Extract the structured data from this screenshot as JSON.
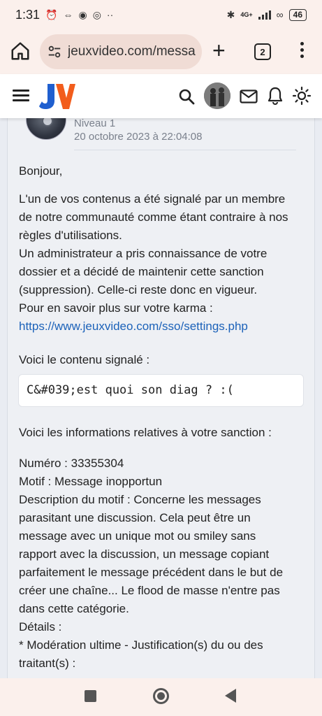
{
  "status_bar": {
    "time": "1:31",
    "network": "4G+",
    "battery": "46"
  },
  "browser": {
    "url": "jeuxvideo.com/messa",
    "tab_count": "2"
  },
  "message": {
    "author_level": "Niveau 1",
    "date": "20 octobre 2023 à 22:04:08",
    "greeting": "Bonjour,",
    "paragraph1": [
      "L'un de vos contenus a été signalé par un membre",
      "de notre communauté comme étant contraire à nos",
      "règles d'utilisations.",
      "Un administrateur a pris connaissance de votre",
      "dossier et a décidé de maintenir cette sanction",
      "(suppression). Celle-ci reste donc en vigueur.",
      "Pour en savoir plus sur votre karma :"
    ],
    "karma_link": "https://www.jeuxvideo.com/sso/settings.php",
    "reported_intro": "Voici le contenu signalé :",
    "reported_content": "C&#039;est quoi son diag ? :(",
    "sanction_intro": "Voici les informations relatives à votre sanction :",
    "sanction_lines": [
      "Numéro : 33355304",
      "Motif : Message inopportun",
      "Description du motif : Concerne les messages",
      "parasitant une discussion. Cela peut être un",
      "message avec un unique mot ou smiley sans",
      "rapport avec la discussion, un message copiant",
      "parfaitement le message précédent dans le but de",
      "créer une chaîne... Le flood de masse n'entre pas",
      "dans cette catégorie.",
      "Détails :",
      "* Modération ultime - Justification(s) du ou des",
      "traitant(s) :"
    ]
  }
}
